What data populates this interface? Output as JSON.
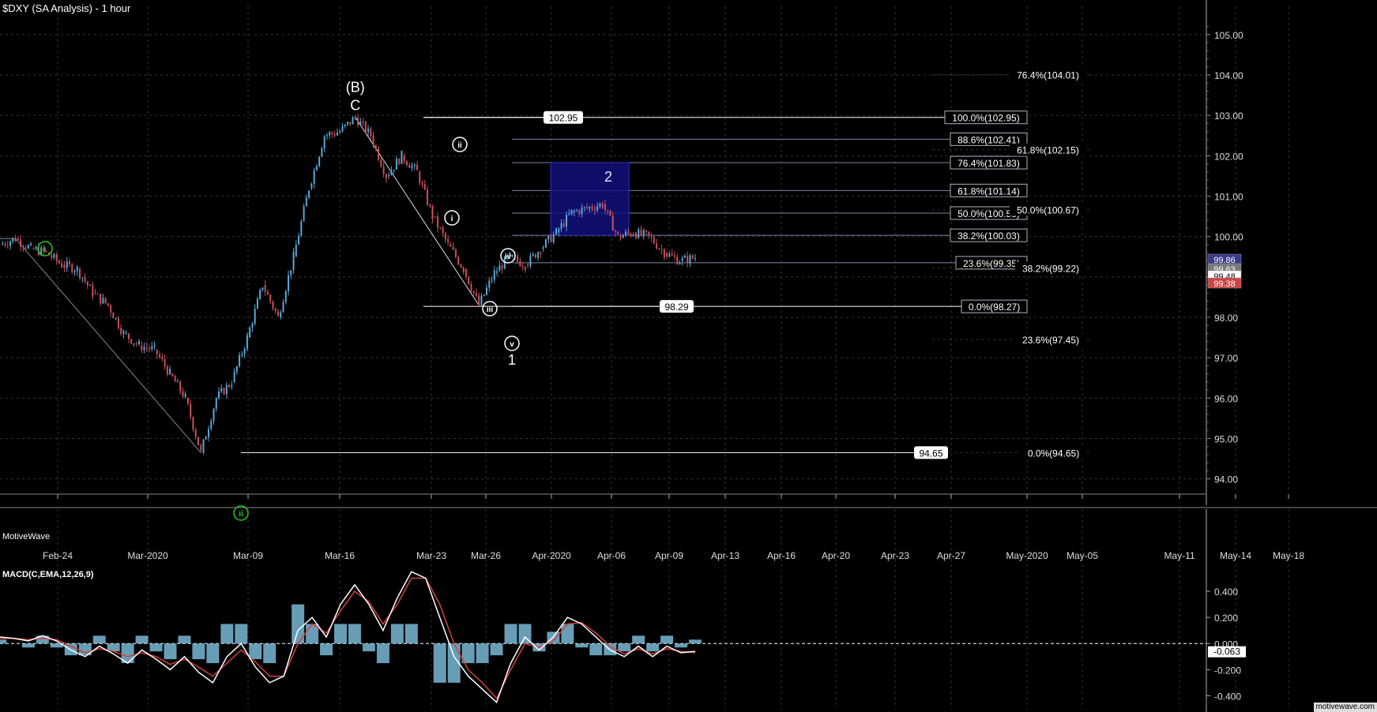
{
  "header": {
    "title": "$DXY (SA Analysis) - 1 hour",
    "brand": "MotiveWave"
  },
  "macd": {
    "title": "MACD(C,EMA,12,26,9)"
  },
  "footer": {
    "site": "motivewave.com"
  },
  "colors": {
    "background": "#000000",
    "up_candle": "#5aa8d8",
    "down_candle": "#c8505a",
    "grid": "#333333",
    "fib_line": "#7a86a6",
    "fib_line_main": "#ffffff",
    "green_label": "#22cc22",
    "target_box": "#10107a",
    "macd_hist": "#7ab8d6",
    "macd_line": "#ffffff",
    "signal_line": "#d04040"
  },
  "chart_data": [
    {
      "type": "candlestick",
      "title": "$DXY (SA Analysis) - 1 hour",
      "price_axis": {
        "ticks": [
          "105.00",
          "104.00",
          "103.00",
          "102.00",
          "101.00",
          "100.00",
          "99.00",
          "98.00",
          "97.00",
          "96.00",
          "95.00",
          "94.00"
        ],
        "ylim": [
          93.7,
          105.7
        ]
      },
      "time_axis": {
        "ticks": [
          "Feb-24",
          "Mar-2020",
          "Mar-09",
          "Mar-16",
          "Mar-23",
          "Mar-26",
          "Apr-2020",
          "Apr-06",
          "Apr-09",
          "Apr-13",
          "Apr-16",
          "Apr-20",
          "Apr-23",
          "Apr-27",
          "May-2020",
          "May-05",
          "May-11",
          "May-14",
          "May-18"
        ]
      },
      "price_path": [
        [
          "Feb-20",
          99.8
        ],
        [
          "Feb-21",
          99.95
        ],
        [
          "Feb-21b",
          99.7
        ],
        [
          "Feb-24",
          99.6
        ],
        [
          "Feb-25",
          99.3
        ],
        [
          "Feb-26",
          99.2
        ],
        [
          "Feb-27",
          98.6
        ],
        [
          "Feb-28",
          98.3
        ],
        [
          "Mar-02",
          97.6
        ],
        [
          "Mar-03",
          97.3
        ],
        [
          "Mar-04",
          97.2
        ],
        [
          "Mar-05",
          96.6
        ],
        [
          "Mar-06",
          96.0
        ],
        [
          "Mar-09",
          94.65
        ],
        [
          "Mar-10",
          96.0
        ],
        [
          "Mar-11",
          96.4
        ],
        [
          "Mar-12",
          97.5
        ],
        [
          "Mar-13",
          98.8
        ],
        [
          "Mar-16",
          98.0
        ],
        [
          "Mar-17",
          99.5
        ],
        [
          "Mar-18",
          101.2
        ],
        [
          "Mar-19",
          102.5
        ],
        [
          "Mar-20",
          102.6
        ],
        [
          "Mar-20b",
          102.95
        ],
        [
          "Mar-23",
          102.5
        ],
        [
          "Mar-23b",
          101.5
        ],
        [
          "Mar-24",
          102.0
        ],
        [
          "Mar-25",
          101.6
        ],
        [
          "Mar-25b",
          100.5
        ],
        [
          "Mar-26",
          99.8
        ],
        [
          "Mar-26b",
          99.2
        ],
        [
          "Mar-27",
          98.3
        ],
        [
          "Mar-27b",
          99.1
        ],
        [
          "Mar-30",
          99.5
        ],
        [
          "Mar-31",
          99.3
        ],
        [
          "Apr-01",
          99.7
        ],
        [
          "Apr-02",
          100.1
        ],
        [
          "Apr-03",
          100.6
        ],
        [
          "Apr-06",
          100.7
        ],
        [
          "Apr-06b",
          100.8
        ],
        [
          "Apr-07",
          100.0
        ],
        [
          "Apr-08",
          100.1
        ],
        [
          "Apr-08b",
          100.0
        ],
        [
          "Apr-09",
          99.6
        ],
        [
          "Apr-09b",
          99.4
        ],
        [
          "Apr-10",
          99.48
        ]
      ],
      "current_labels": [
        "99.86",
        "99.63",
        "99.48",
        "99.38"
      ],
      "wave_labels": [
        {
          "text": "(B)",
          "style": "plain"
        },
        {
          "text": "C",
          "style": "plain"
        },
        {
          "text": "i",
          "style": "circle",
          "color": "#ffffff"
        },
        {
          "text": "ii",
          "style": "circle",
          "color": "#ffffff"
        },
        {
          "text": "iii",
          "style": "circle",
          "color": "#ffffff"
        },
        {
          "text": "iv",
          "style": "circle",
          "color": "#ffffff"
        },
        {
          "text": "v",
          "style": "circle",
          "color": "#ffffff"
        },
        {
          "text": "1",
          "style": "plain"
        },
        {
          "text": "2",
          "style": "plain-blue"
        },
        {
          "text": "i",
          "style": "circle",
          "color": "#22cc22"
        },
        {
          "text": "ii",
          "style": "circle",
          "color": "#22cc22"
        }
      ],
      "price_boxes": [
        {
          "text": "102.95",
          "value": 102.95
        },
        {
          "text": "98.29",
          "value": 98.27
        },
        {
          "text": "94.65",
          "value": 94.65
        }
      ],
      "fib_retrace_inner": [
        {
          "text": "100.0%(102.95)",
          "value": 102.95
        },
        {
          "text": "88.6%(102.41)",
          "value": 102.41
        },
        {
          "text": "76.4%(101.83)",
          "value": 101.83
        },
        {
          "text": "61.8%(101.14)",
          "value": 101.14
        },
        {
          "text": "50.0%(100.58)",
          "value": 100.58
        },
        {
          "text": "38.2%(100.03)",
          "value": 100.03
        },
        {
          "text": "23.6%(99.35)",
          "value": 99.35
        },
        {
          "text": "0.0%(98.27)",
          "value": 98.27
        }
      ],
      "fib_retrace_outer": [
        {
          "text": "76.4%(104.01)",
          "value": 104.01
        },
        {
          "text": "61.8%(102.15)",
          "value": 102.15
        },
        {
          "text": "50.0%(100.67)",
          "value": 100.67
        },
        {
          "text": "38.2%(99.22)",
          "value": 99.22
        },
        {
          "text": "23.6%(97.45)",
          "value": 97.45
        },
        {
          "text": "0.0%(94.65)",
          "value": 94.65
        }
      ],
      "target_zone": {
        "low": 100.03,
        "high": 101.83,
        "label": "2"
      }
    },
    {
      "type": "macd",
      "title": "MACD(C,EMA,12,26,9)",
      "y_axis": {
        "ticks": [
          "0.400",
          "0.200",
          "0.000",
          "-0.200",
          "-0.400"
        ],
        "ylim": [
          -0.5,
          0.6
        ]
      },
      "current_value": "-0.063",
      "macd_line": [
        0.05,
        0.04,
        0.02,
        0.06,
        0.02,
        -0.05,
        -0.1,
        -0.02,
        -0.08,
        -0.15,
        -0.05,
        -0.12,
        -0.2,
        -0.1,
        -0.22,
        -0.3,
        -0.1,
        0.0,
        -0.18,
        -0.3,
        -0.25,
        0.1,
        0.2,
        0.05,
        0.3,
        0.45,
        0.3,
        0.1,
        0.35,
        0.55,
        0.5,
        0.2,
        -0.1,
        -0.25,
        -0.35,
        -0.45,
        -0.15,
        0.05,
        -0.05,
        0.05,
        0.2,
        0.15,
        0.05,
        -0.05,
        -0.1,
        -0.02,
        -0.1,
        -0.02,
        -0.07,
        -0.06
      ],
      "signal_line": [
        0.04,
        0.04,
        0.03,
        0.04,
        0.03,
        -0.02,
        -0.07,
        -0.04,
        -0.06,
        -0.1,
        -0.07,
        -0.1,
        -0.16,
        -0.12,
        -0.18,
        -0.25,
        -0.15,
        -0.05,
        -0.14,
        -0.25,
        -0.25,
        0.0,
        0.15,
        0.08,
        0.25,
        0.4,
        0.32,
        0.15,
        0.3,
        0.5,
        0.5,
        0.3,
        0.0,
        -0.2,
        -0.3,
        -0.42,
        -0.2,
        0.0,
        -0.03,
        0.02,
        0.15,
        0.16,
        0.08,
        -0.02,
        -0.08,
        -0.04,
        -0.08,
        -0.04,
        -0.06,
        -0.07
      ],
      "histogram": [
        0.01,
        0.0,
        -0.01,
        0.02,
        -0.01,
        -0.03,
        -0.03,
        0.02,
        -0.02,
        -0.05,
        0.02,
        -0.02,
        -0.04,
        0.02,
        -0.04,
        -0.05,
        0.05,
        0.05,
        -0.04,
        -0.05,
        0.0,
        0.1,
        0.05,
        -0.03,
        0.05,
        0.05,
        -0.02,
        -0.05,
        0.05,
        0.05,
        0.0,
        -0.1,
        -0.1,
        -0.05,
        -0.05,
        -0.03,
        0.05,
        0.05,
        -0.02,
        0.03,
        0.05,
        -0.01,
        -0.03,
        -0.03,
        -0.02,
        0.02,
        -0.02,
        0.02,
        -0.01,
        0.01
      ]
    }
  ]
}
